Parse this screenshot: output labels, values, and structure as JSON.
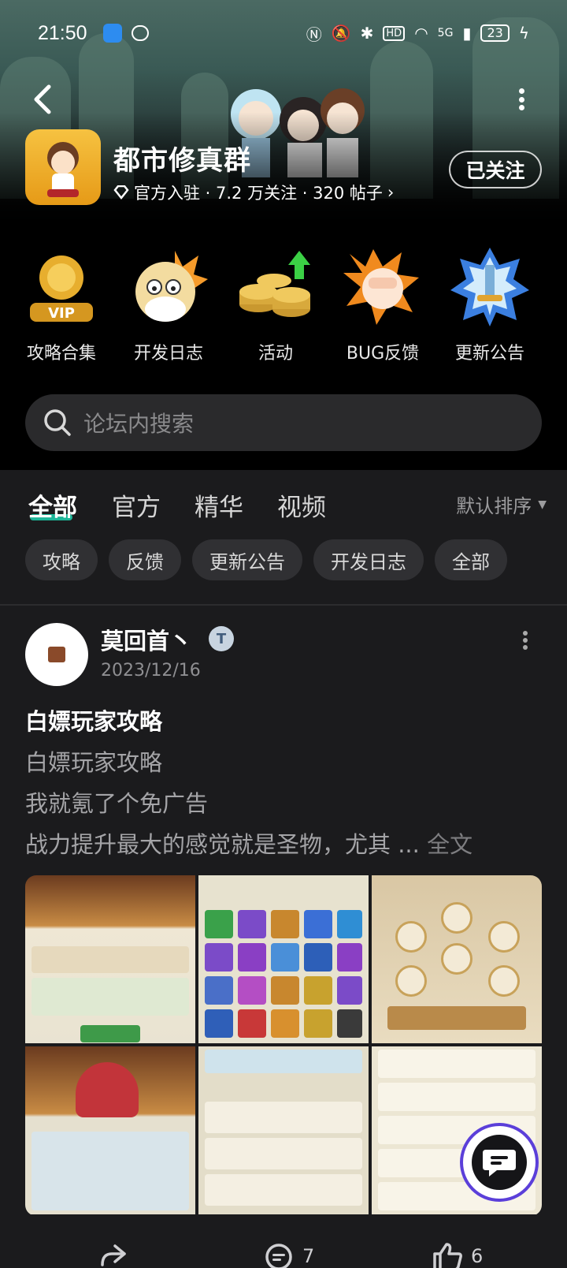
{
  "status_bar": {
    "time": "21:50",
    "network": "5G",
    "battery": "23"
  },
  "forum": {
    "name": "都市修真群",
    "meta": "官方入驻 · 7.2 万关注 · 320 帖子",
    "follow_label": "已关注"
  },
  "quick_entries": [
    {
      "label": "攻略合集",
      "icon": "vip-trophy-icon"
    },
    {
      "label": "开发日志",
      "icon": "doge-icon"
    },
    {
      "label": "活动",
      "icon": "coins-icon"
    },
    {
      "label": "BUG反馈",
      "icon": "fist-icon"
    },
    {
      "label": "更新公告",
      "icon": "sword-badge-icon"
    }
  ],
  "search": {
    "placeholder": "论坛内搜索"
  },
  "tabs": [
    "全部",
    "官方",
    "精华",
    "视频"
  ],
  "sort_label": "默认排序",
  "chips": [
    "攻略",
    "反馈",
    "更新公告",
    "开发日志",
    "全部"
  ],
  "post": {
    "author": "莫回首丶",
    "badge": "T",
    "date": "2023/12/16",
    "title": "白嫖玩家攻略",
    "lines": [
      "白嫖玩家攻略",
      "我就氪了个免广告",
      "战力提升最大的感觉就是圣物，尤其 ..."
    ],
    "fulltext_label": "全文",
    "comments": "7",
    "likes": "6"
  },
  "colors": {
    "accent": "#1ec7a6",
    "background": "#1b1b1d"
  }
}
